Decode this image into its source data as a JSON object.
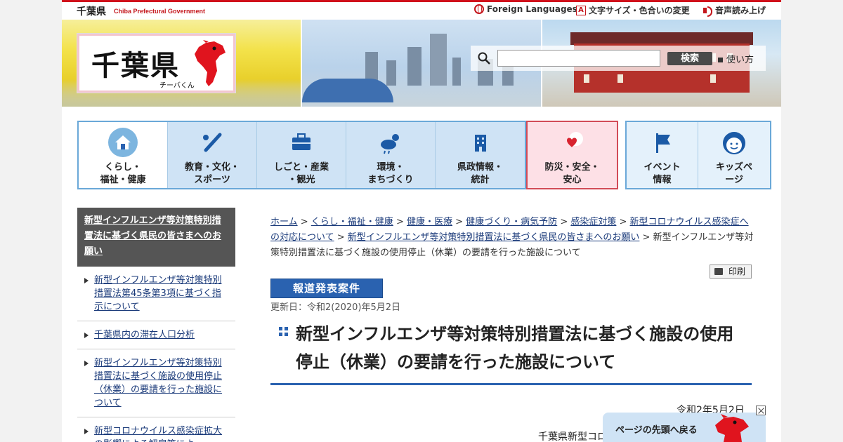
{
  "topbar": {
    "pref_name": "千葉県",
    "pref_en": "Chiba Prefectural Government",
    "links": [
      {
        "label": "Foreign Languages",
        "icon": "globe-icon"
      },
      {
        "label": "文字サイズ・色合いの変更",
        "icon": "text-size-icon"
      },
      {
        "label": "音声読み上げ",
        "icon": "speaker-icon"
      }
    ]
  },
  "logo": {
    "title": "千葉県",
    "mascot_caption": "チーバくん"
  },
  "search": {
    "placeholder": "",
    "button": "検索",
    "help": "使い方"
  },
  "nav": {
    "items": [
      {
        "label": "くらし・\n福祉・健康",
        "icon": "house-icon"
      },
      {
        "label": "教育・文化・\nスポーツ",
        "icon": "bat-ball-icon"
      },
      {
        "label": "しごと・産業\n・観光",
        "icon": "briefcase-icon"
      },
      {
        "label": "環境・\nまちづくり",
        "icon": "weather-icon"
      },
      {
        "label": "県政情報・\n統計",
        "icon": "building-icon"
      },
      {
        "label": "防災・安全・\n安心",
        "icon": "heart-hand-icon"
      },
      {
        "label": "イベント\n情報",
        "icon": "flag-icon"
      },
      {
        "label": "キッズペ\nージ",
        "icon": "kid-face-icon"
      }
    ]
  },
  "sidebar": {
    "heading": "新型インフルエンザ等対策特別措置法に基づく県民の皆さまへのお願い",
    "items": [
      "新型インフルエンザ等対策特別措置法第45条第3項に基づく指示について",
      "千葉県内の滞在人口分析",
      "新型インフルエンザ等対策特別措置法に基づく施設の使用停止（休業）の要請を行った施設について",
      "新型コロナウイルス感染症拡大の影響による解雇等によ"
    ]
  },
  "breadcrumb": {
    "links": [
      "ホーム",
      "くらし・福祉・健康",
      "健康・医療",
      "健康づくり・病気予防",
      "感染症対策",
      "新型コロナウイルス感染症への対応について",
      "新型インフルエンザ等対策特別措置法に基づく県民の皆さまへのお願い"
    ],
    "separator": " > ",
    "current": "新型インフルエンザ等対策特別措置法に基づく施設の使用停止（休業）の要請を行った施設について"
  },
  "article": {
    "print": "印刷",
    "badge": "報道発表案件",
    "updated": "更新日：令和2(2020)年5月2日",
    "title": "新型インフルエンザ等対策特別措置法に基づく施設の使用停止（休業）の要請を行った施設について",
    "date": "令和2年5月2日",
    "org": "千葉県新型コロナウイルス感染症"
  },
  "back_to_top": {
    "label": "ページの先頭へ戻る"
  },
  "colors": {
    "accent_red": "#d0101b",
    "nav_blue": "#6aa8d8",
    "link_blue": "#1a3a7a",
    "badge_blue": "#2a62b0"
  }
}
